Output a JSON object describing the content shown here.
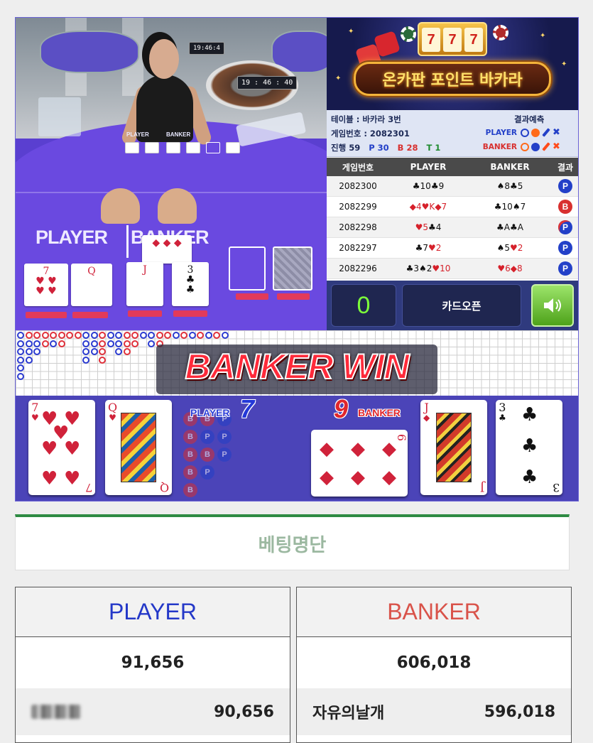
{
  "video": {
    "clock_small": "19:46:4",
    "clock_main": "19 : 46 : 40",
    "felt_player": "PLAYER",
    "felt_banker": "BANKER",
    "mini_player": "PLAYER",
    "mini_banker": "BANKER"
  },
  "banner": {
    "slot_digits": [
      "7",
      "7",
      "7"
    ],
    "title": "온카판 포인트 바카라"
  },
  "info": {
    "table": "테이블 : 바카라 3번",
    "game_no": "게임번호 : 2082301",
    "progress_label": "진행",
    "progress_count": "59",
    "player_count": "P 30",
    "banker_count": "B 28",
    "tie_count": "T 1",
    "prediction_title": "결과예측",
    "pred_player": "PLAYER",
    "pred_banker": "BANKER"
  },
  "history": {
    "headers": [
      "게임번호",
      "PLAYER",
      "BANKER",
      "결과"
    ],
    "rows": [
      {
        "no": "2082300",
        "player": [
          {
            "s": "♣10",
            "r": false
          },
          {
            "s": "♣9",
            "r": false
          }
        ],
        "banker": [
          {
            "s": "♠8",
            "r": false
          },
          {
            "s": "♣5",
            "r": false
          }
        ],
        "result": "P",
        "kind": "p"
      },
      {
        "no": "2082299",
        "player": [
          {
            "s": "◆4",
            "r": true
          },
          {
            "s": "♥K",
            "r": true
          },
          {
            "s": "◆7",
            "r": true
          }
        ],
        "banker": [
          {
            "s": "♣10",
            "r": false
          },
          {
            "s": "♠7",
            "r": false
          }
        ],
        "result": "B",
        "kind": "b"
      },
      {
        "no": "2082298",
        "player": [
          {
            "s": "♥5",
            "r": true
          },
          {
            "s": "♣4",
            "r": false
          }
        ],
        "banker": [
          {
            "s": "♣A",
            "r": false
          },
          {
            "s": "♣A",
            "r": false
          }
        ],
        "result": "P",
        "kind": "pp"
      },
      {
        "no": "2082297",
        "player": [
          {
            "s": "♣7",
            "r": false
          },
          {
            "s": "♥2",
            "r": true
          }
        ],
        "banker": [
          {
            "s": "♠5",
            "r": false
          },
          {
            "s": "♥2",
            "r": true
          }
        ],
        "result": "P",
        "kind": "p"
      },
      {
        "no": "2082296",
        "player": [
          {
            "s": "♣3",
            "r": false
          },
          {
            "s": "♠2",
            "r": false
          },
          {
            "s": "♥10",
            "r": true
          }
        ],
        "banker": [
          {
            "s": "♥6",
            "r": true
          },
          {
            "s": "◆8",
            "r": true
          }
        ],
        "result": "P",
        "kind": "p"
      }
    ]
  },
  "controls": {
    "countdown": "0",
    "open_label": "카드오픈",
    "sound_icon": "speaker-icon"
  },
  "result": {
    "win_text": "BANKER WIN",
    "player_label": "PLAYER",
    "player_score": "7",
    "banker_label": "BANKER",
    "banker_score": "9",
    "player_cards": [
      {
        "rank": "7",
        "suit": "♥"
      },
      {
        "rank": "Q",
        "suit": "♥"
      }
    ],
    "banker_cards": [
      {
        "rank": "6",
        "suit": "◆"
      },
      {
        "rank": "J",
        "suit": "◆"
      },
      {
        "rank": "3",
        "suit": "♣"
      }
    ]
  },
  "betting": {
    "title": "베팅명단",
    "player": {
      "label": "PLAYER",
      "total": "91,656",
      "entry_amount": "90,656",
      "color": "#2438c8"
    },
    "banker": {
      "label": "BANKER",
      "total": "606,018",
      "entry_name": "자유의날개",
      "entry_amount": "596,018",
      "color": "#d9534a"
    }
  },
  "colors": {
    "frame": "#4b44b8",
    "felt": "#6a49e0",
    "player_blue": "#2340c8",
    "banker_red": "#d8302f",
    "countdown_green": "#7dff3a"
  }
}
